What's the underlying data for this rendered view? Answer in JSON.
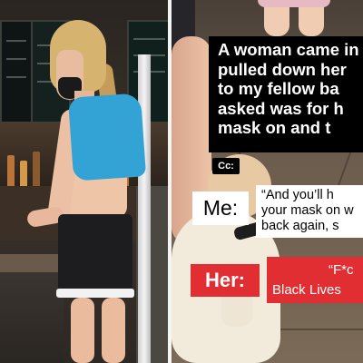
{
  "caption": {
    "lines": [
      "A woman came in",
      "pulled down her",
      "to my fellow ba",
      "asked was for h",
      "mask on and t"
    ]
  },
  "cc_label": "Cc:",
  "me": {
    "label": "Me:",
    "quote_lines": [
      "“And you’ll h",
      "your mask on w",
      "back again, s"
    ]
  },
  "her": {
    "label": "Her:",
    "quote_open": "“F*c",
    "quote_rest": "Black Lives"
  },
  "colors": {
    "caption_bg": "#000000",
    "caption_text": "#ffffff",
    "her_accent": "#e02e33",
    "me_bg": "#ffffff",
    "top_blue": "#33a3d6"
  }
}
